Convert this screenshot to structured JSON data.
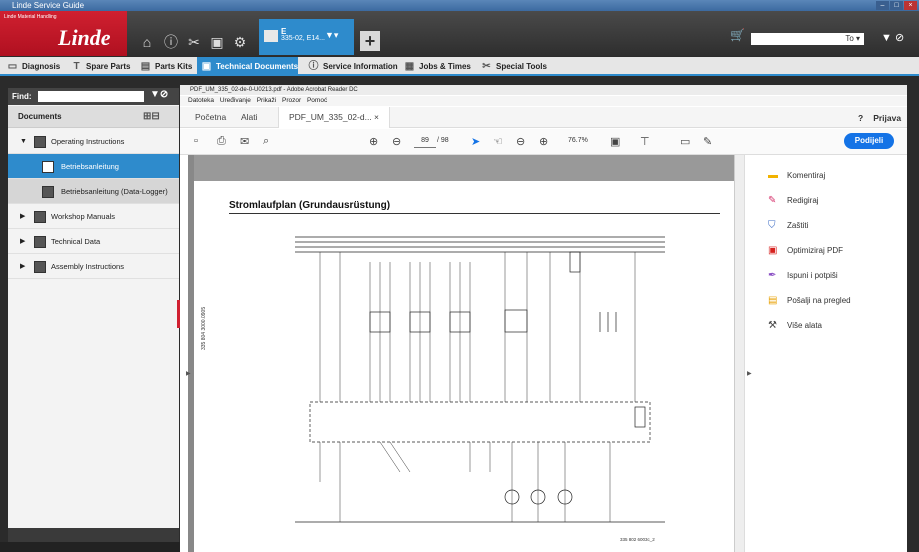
{
  "window": {
    "title": "Linde Service Guide"
  },
  "header": {
    "brand_small": "Linde Material Handling",
    "brand": "Linde",
    "context": {
      "line1": "E",
      "line2": "335-02, E14..."
    },
    "search_value": "To ▾",
    "icons": [
      "home-icon",
      "info-icon",
      "tools-icon",
      "truck-icon",
      "gear-icon"
    ]
  },
  "tabs": [
    {
      "label": "Diagnosis",
      "icon": "monitor-icon"
    },
    {
      "label": "Spare Parts",
      "icon": "parts-icon"
    },
    {
      "label": "Parts Kits",
      "icon": "kits-icon"
    },
    {
      "label": "Technical Documents",
      "icon": "document-icon",
      "active": true
    },
    {
      "label": "Service Information",
      "icon": "info-icon"
    },
    {
      "label": "Jobs & Times",
      "icon": "jobs-icon"
    },
    {
      "label": "Special Tools",
      "icon": "tools-icon"
    }
  ],
  "left": {
    "find_label": "Find:",
    "documents_label": "Documents",
    "tree": [
      {
        "label": "Operating Instructions",
        "expanded": true
      },
      {
        "label": "Betriebsanleitung",
        "selected": true
      },
      {
        "label": "Betriebsanleitung (Data-Logger)"
      },
      {
        "label": "Workshop Manuals"
      },
      {
        "label": "Technical Data"
      },
      {
        "label": "Assembly Instructions"
      }
    ]
  },
  "acrobat": {
    "title": "PDF_UM_335_02-de-0-U0213.pdf - Adobe Acrobat Reader DC",
    "menu": "Datoteka Uređivanje Prikaži Prozor Pomoć",
    "tabs": [
      "Početna",
      "Alati",
      "PDF_UM_335_02-d... ×"
    ],
    "signin": "Prijava",
    "page_current": "89",
    "page_total": "/ 98",
    "zoom": "76.7%",
    "share": "Podijeli",
    "right_tools": [
      {
        "label": "Komentiraj",
        "icon": "comment-icon",
        "color": "#f2b300"
      },
      {
        "label": "Redigiraj",
        "icon": "redact-icon",
        "color": "#d6336c"
      },
      {
        "label": "Zaštiti",
        "icon": "shield-icon",
        "color": "#3d6cc4"
      },
      {
        "label": "Optimiziraj PDF",
        "icon": "optimize-icon",
        "color": "#d6221f"
      },
      {
        "label": "Ispuni i potpiši",
        "icon": "sign-icon",
        "color": "#8a4fc4"
      },
      {
        "label": "Pošalji na pregled",
        "icon": "send-icon",
        "color": "#e8a000"
      },
      {
        "label": "Više alata",
        "icon": "more-tools-icon",
        "color": "#444444"
      }
    ]
  },
  "document": {
    "title": "Stromlaufplan (Grundausrüstung)",
    "side_code": "335 804 3000.0905",
    "doc_number": "335 802 6003c_2"
  }
}
